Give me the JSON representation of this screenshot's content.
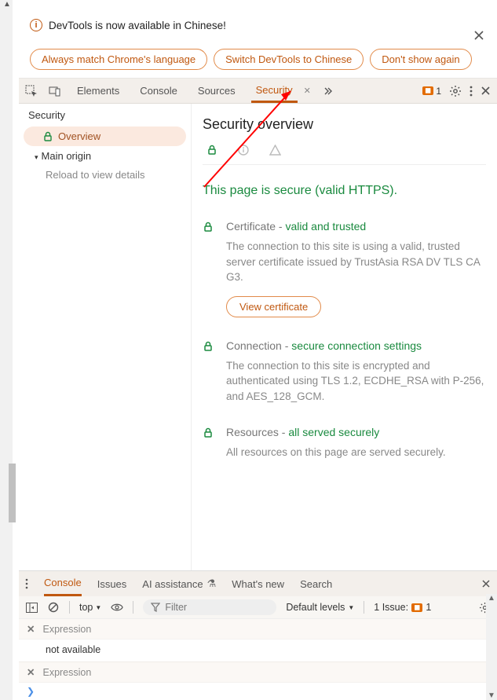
{
  "infobar": {
    "message": "DevTools is now available in Chinese!",
    "buttons": [
      "Always match Chrome's language",
      "Switch DevTools to Chinese",
      "Don't show again"
    ]
  },
  "tabs": {
    "items": [
      "Elements",
      "Console",
      "Sources",
      "Security"
    ],
    "active": "Security",
    "issue_count": "1"
  },
  "sidebar": {
    "title": "Security",
    "overview_label": "Overview",
    "group_label": "Main origin",
    "detail_hint": "Reload to view details"
  },
  "overview": {
    "heading": "Security overview",
    "headline": "This page is secure (valid HTTPS).",
    "cert_title_prefix": "Certificate - ",
    "cert_title_status": "valid and trusted",
    "cert_desc": "The connection to this site is using a valid, trusted server certificate issued by TrustAsia RSA DV TLS CA G3.",
    "view_cert_label": "View certificate",
    "conn_title_prefix": "Connection - ",
    "conn_title_status": "secure connection settings",
    "conn_desc": "The connection to this site is encrypted and authenticated using TLS 1.2, ECDHE_RSA with P-256, and AES_128_GCM.",
    "res_title_prefix": "Resources - ",
    "res_title_status": "all served securely",
    "res_desc": "All resources on this page are served securely."
  },
  "drawer": {
    "tabs": [
      "Console",
      "Issues",
      "AI assistance",
      "What's new",
      "Search"
    ],
    "active": "Console"
  },
  "console": {
    "context": "top",
    "filter_placeholder": "Filter",
    "levels_label": "Default levels",
    "issues_label": "1 Issue:",
    "issues_count": "1",
    "rows": [
      {
        "label": "Expression",
        "value": "not available"
      },
      {
        "label": "Expression"
      }
    ]
  }
}
